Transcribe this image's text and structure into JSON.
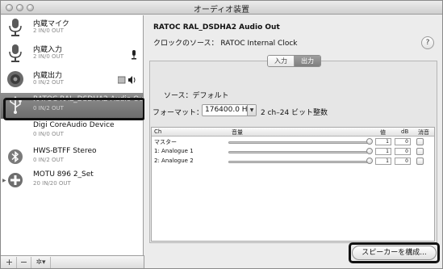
{
  "window": {
    "title": "オーディオ装置"
  },
  "sidebar": {
    "devices": [
      {
        "name": "内蔵マイク",
        "sub": "2 IN/0 OUT",
        "icon": "microphone-icon"
      },
      {
        "name": "内蔵入力",
        "sub": "2 IN/0 OUT",
        "icon": "microphone-icon",
        "badge_icon": "microphone-small-icon"
      },
      {
        "name": "内蔵出力",
        "sub": "0 IN/2 OUT",
        "icon": "speaker-icon",
        "badge_icon": "speaker-volume-icon"
      },
      {
        "name": "RATOC RAL_DSDHA2 Audio Out",
        "sub": "0 IN/2 OUT",
        "icon": "usb-icon",
        "selected": true
      },
      {
        "name": "Digi CoreAudio Device",
        "sub": "0 IN/0 OUT",
        "icon": ""
      },
      {
        "name": "HWS-BTFF Stereo",
        "sub": "0 IN/2 OUT",
        "icon": "bluetooth-icon"
      },
      {
        "name": "MOTU 896 2_Set",
        "sub": "20 IN/20 OUT",
        "icon": "aggregate-device-icon"
      }
    ],
    "bottom_buttons": {
      "add": "+",
      "remove": "−",
      "settings": "✲▾"
    }
  },
  "main": {
    "device_title": "RATOC RAL_DSDHA2 Audio Out",
    "clock_source": "クロックのソース： RATOC Internal Clock",
    "help": "?",
    "tabs": [
      {
        "label": "入力",
        "active": false
      },
      {
        "label": "出力",
        "active": true
      }
    ],
    "source": "ソース：デフォルト",
    "format_label": "フォーマット：",
    "format_value": "176400.0 H",
    "format_bits": "2 ch–24 ビット整数",
    "table": {
      "headers": {
        "ch": "Ch",
        "volume": "音量",
        "value": "値",
        "db": "dB",
        "mute": "消音"
      },
      "rows": [
        {
          "ch": "マスター",
          "value": "1",
          "db": "0",
          "muted": false
        },
        {
          "ch": "1: Analogue 1",
          "value": "1",
          "db": "0",
          "muted": false
        },
        {
          "ch": "2: Analogue 2",
          "value": "1",
          "db": "0",
          "muted": false
        }
      ]
    },
    "configure_speakers": "スピーカーを構成..."
  }
}
